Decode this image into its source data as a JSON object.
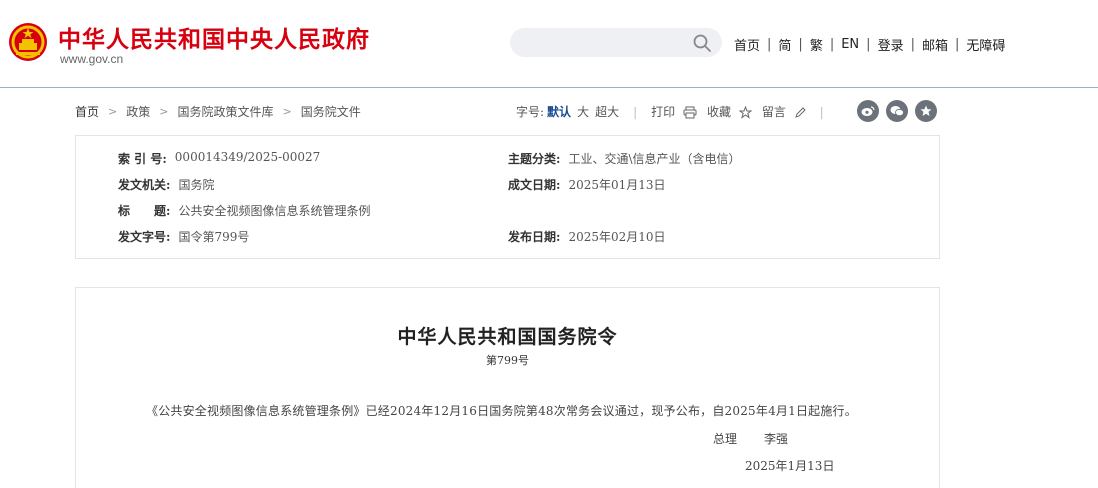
{
  "header": {
    "site_title": "中华人民共和国中央人民政府",
    "site_url": "www.gov.cn",
    "search": {
      "placeholder": "",
      "value": ""
    },
    "nav": [
      "首页",
      "简",
      "繁",
      "EN",
      "登录",
      "邮箱",
      "无障碍"
    ],
    "nav_separator": "|"
  },
  "breadcrumb": {
    "items": [
      "首页",
      "政策",
      "国务院政策文件库",
      "国务院文件"
    ],
    "arrow": ">"
  },
  "tools": {
    "font_size_label": "字号:",
    "font_sizes": [
      "默认",
      "大",
      "超大"
    ],
    "print_label": "打印",
    "favorite_label": "收藏",
    "comment_label": "留言",
    "separator": "|"
  },
  "share_icons": [
    "weibo-icon",
    "wechat-icon",
    "favorite-star-icon"
  ],
  "info": {
    "index_no_label": "索 引 号:",
    "index_no": "000014349/2025-00027",
    "category_label": "主题分类:",
    "category": "工业、交通\\信息产业（含电信）",
    "issuer_label": "发文机关:",
    "issuer": "国务院",
    "written_date_label": "成文日期:",
    "written_date": "2025年01月13日",
    "title_label": "标　　题:",
    "title": "公共安全视频图像信息系统管理条例",
    "doc_no_label": "发文字号:",
    "doc_no": "国令第799号",
    "publish_date_label": "发布日期:",
    "publish_date": "2025年02月10日"
  },
  "document": {
    "heading": "中华人民共和国国务院令",
    "number": "第799号",
    "body": "《公共安全视频图像信息系统管理条例》已经2024年12月16日国务院第48次常务会议通过，现予公布，自2025年4月1日起施行。",
    "sign_role": "总理",
    "sign_name": "李强",
    "sign_date": "2025年1月13日"
  },
  "colors": {
    "brand_red": "#d6000f",
    "accent_blue": "#1a4d8f",
    "share_icon_gray": "#6c7279"
  }
}
